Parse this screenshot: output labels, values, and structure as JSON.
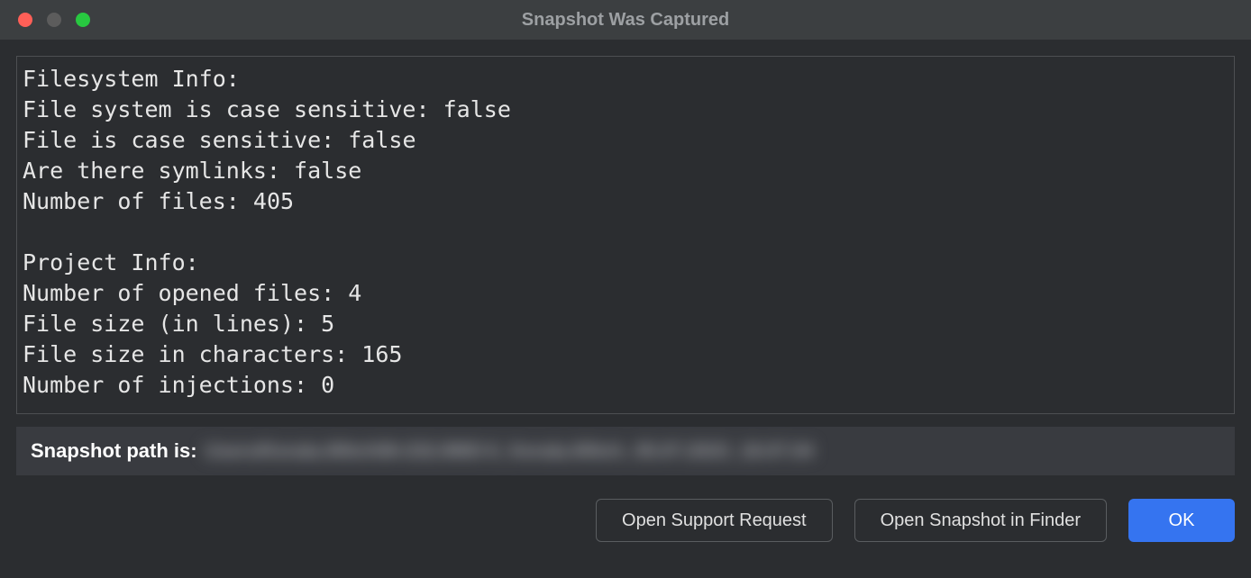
{
  "window": {
    "title": "Snapshot Was Captured"
  },
  "info": {
    "filesystem_header": "Filesystem Info:",
    "fs_case_sensitive_label": "File system is case sensitive:",
    "fs_case_sensitive_value": "false",
    "file_case_sensitive_label": "File is case sensitive:",
    "file_case_sensitive_value": "false",
    "symlinks_label": "Are there symlinks:",
    "symlinks_value": "false",
    "num_files_label": "Number of files:",
    "num_files_value": "405",
    "project_header": "Project Info:",
    "opened_files_label": "Number of opened files:",
    "opened_files_value": "4",
    "file_size_lines_label": "File size (in lines):",
    "file_size_lines_value": "5",
    "file_size_chars_label": "File size in characters:",
    "file_size_chars_value": "165",
    "injections_label": "Number of injections:",
    "injections_value": "0"
  },
  "path": {
    "label": "Snapshot path is:",
    "value_redacted": "Users/Kerala.Witch58-232.8983 6_Kerala.Witch_05.07.2023_18.07.04"
  },
  "buttons": {
    "support": "Open Support Request",
    "finder": "Open Snapshot in Finder",
    "ok": "OK"
  }
}
